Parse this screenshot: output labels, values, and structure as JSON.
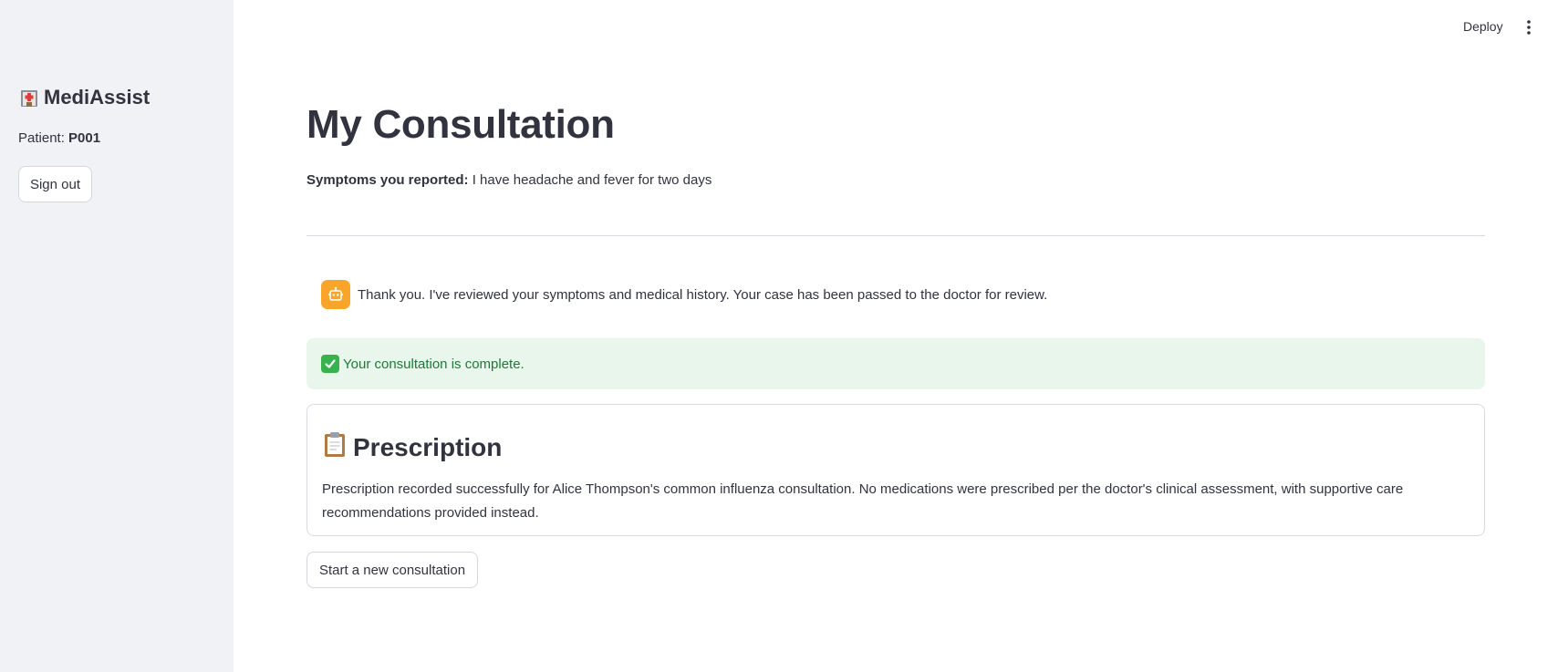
{
  "sidebar": {
    "brand_icon": "hospital-icon",
    "brand_title": "MediAssist",
    "patient_label": "Patient:",
    "patient_id": "P001",
    "signout_label": "Sign out"
  },
  "header": {
    "deploy_label": "Deploy",
    "menu_icon": "kebab-menu-icon"
  },
  "main": {
    "title": "My Consultation",
    "symptoms_label": "Symptoms you reported:",
    "symptoms_text": "I have headache and fever for two days",
    "assistant_icon": "robot-icon",
    "assistant_message": "Thank you. I've reviewed your symptoms and medical history. Your case has been passed to the doctor for review.",
    "success_icon": "check-mark-icon",
    "success_message": "Your consultation is complete.",
    "prescription": {
      "icon": "clipboard-icon",
      "title": "Prescription",
      "text": "Prescription recorded successfully for Alice Thompson's common influenza consultation. No medications were prescribed per the doctor's clinical assessment, with supportive care recommendations provided instead."
    },
    "new_consultation_label": "Start a new consultation"
  },
  "colors": {
    "sidebar_bg": "#f0f2f6",
    "success_bg": "#e8f6ec",
    "success_text": "#1f7a3a",
    "bot_avatar": "#f8a52a",
    "text": "#31333f"
  }
}
